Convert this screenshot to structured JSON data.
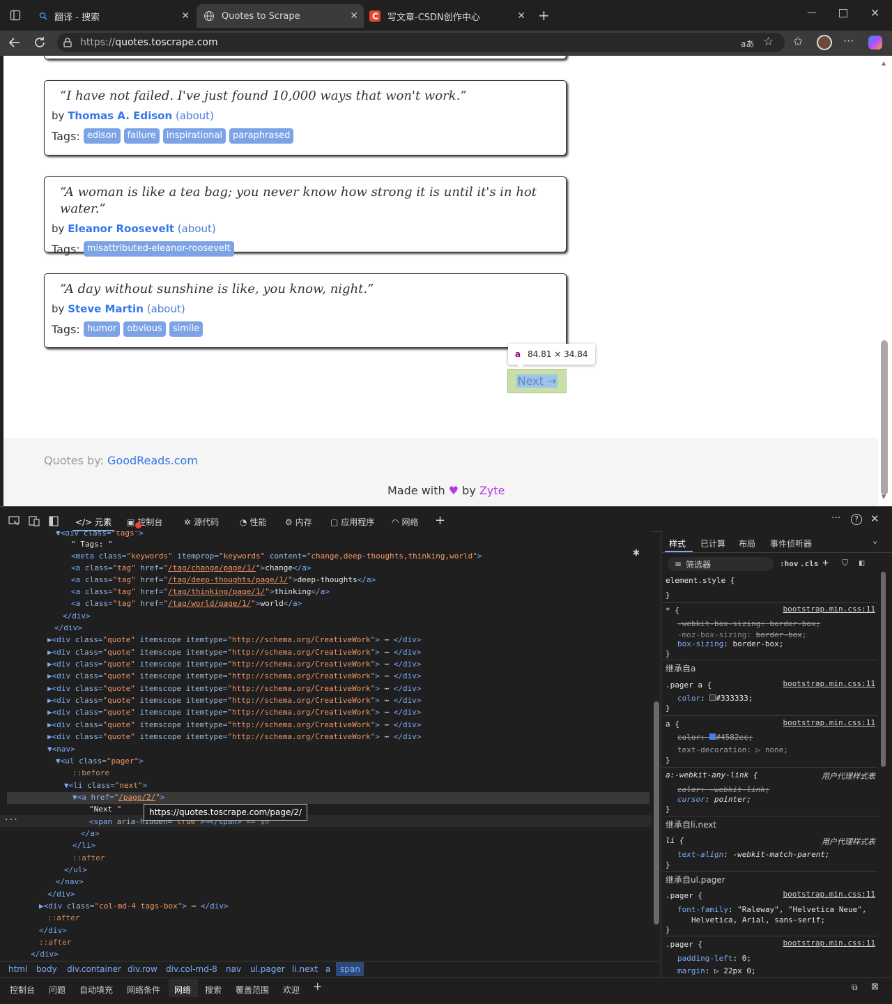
{
  "browser": {
    "tabs": [
      {
        "title": "翻译 - 搜索",
        "icon": "search-icon"
      },
      {
        "title": "Quotes to Scrape",
        "icon": "globe-icon"
      },
      {
        "title": "写文章-CSDN创作中心",
        "icon": "csdn-icon"
      }
    ],
    "url_prefix": "https://",
    "url_host": "quotes.toscrape.com",
    "translate_label": "aあ"
  },
  "page": {
    "quotes": [
      {
        "text": "“I have not failed. I've just found 10,000 ways that won't work.”",
        "by": "by",
        "author": "Thomas A. Edison",
        "about": "(about)",
        "tags_label": "Tags:",
        "tags": [
          "edison",
          "failure",
          "inspirational",
          "paraphrased"
        ]
      },
      {
        "text": "“A woman is like a tea bag; you never know how strong it is until it's in hot water.”",
        "by": "by",
        "author": "Eleanor Roosevelt",
        "about": "(about)",
        "tags_label": "Tags:",
        "tags": [
          "misattributed-eleanor-roosevelt"
        ]
      },
      {
        "text": "“A day without sunshine is like, you know, night.”",
        "by": "by",
        "author": "Steve Martin",
        "about": "(about)",
        "tags_label": "Tags:",
        "tags": [
          "humor",
          "obvious",
          "simile"
        ]
      }
    ],
    "tooltip_tag": "a",
    "tooltip_size": "84.81 × 34.84",
    "next_label": "Next →",
    "footer_left_prefix": "Quotes by: ",
    "footer_left_link": "GoodReads.com",
    "footer_made": "Made with",
    "footer_by": "by",
    "footer_zyte": "Zyte",
    "heart": "♥"
  },
  "devtools": {
    "tabs": [
      "元素",
      "控制台",
      "源代码",
      "性能",
      "内存",
      "应用程序",
      "网络"
    ],
    "styles_tabs": [
      "样式",
      "已计算",
      "布局",
      "事件侦听器"
    ],
    "filter_placeholder": "筛选器",
    "hov": ":hov",
    "cls": ".cls",
    "link_tooltip": "https://quotes.toscrape.com/page/2/",
    "breadcrumbs": [
      "html",
      "body",
      "div.container",
      "div.row",
      "div.col-md-8",
      "nav",
      "ul.pager",
      "li.next",
      "a",
      "span"
    ],
    "drawer_tabs": [
      "控制台",
      "问题",
      "自动填充",
      "网络条件",
      "网络",
      "搜索",
      "覆盖范围",
      "欢迎"
    ],
    "inherited_a": "继承自a",
    "inherited_li": "继承自li.next",
    "inherited_ul": "继承自ul.pager",
    "ua_stylesheet": "用户代理样式表",
    "src_file": "bootstrap.min.css:11"
  }
}
